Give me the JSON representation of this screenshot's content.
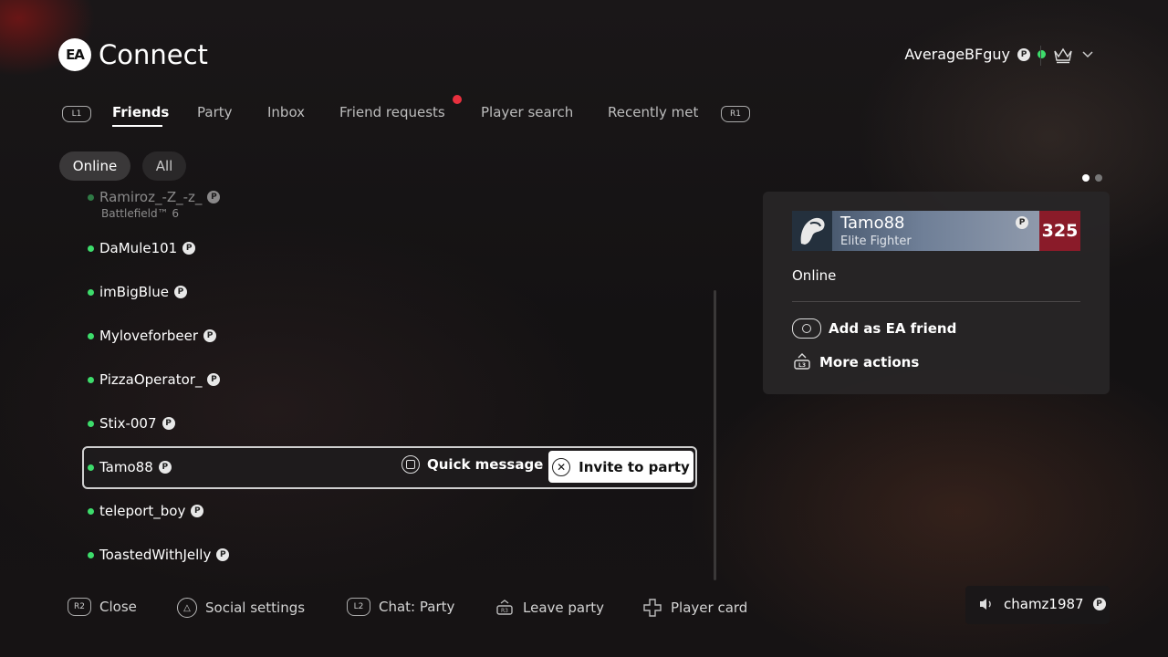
{
  "header": {
    "logo_text": "EA",
    "title": "Connect",
    "username": "AverageBFguy",
    "platform_badge": "ps"
  },
  "tabs": {
    "l_hint": "L1",
    "r_hint": "R1",
    "items": [
      "Friends",
      "Party",
      "Inbox",
      "Friend requests",
      "Player search",
      "Recently met"
    ],
    "active": "Friends"
  },
  "filters": {
    "online": "Online",
    "all": "All",
    "selected": "Online"
  },
  "friends": [
    {
      "name": "Ramiroz_-Z_-z_",
      "game": "Battlefield™ 6"
    },
    {
      "name": "DaMule101"
    },
    {
      "name": "imBigBlue"
    },
    {
      "name": "Myloveforbeer"
    },
    {
      "name": "PizzaOperator_"
    },
    {
      "name": "Stix-007"
    },
    {
      "name": "Tamo88"
    },
    {
      "name": "teleport_boy"
    },
    {
      "name": "ToastedWithJelly"
    }
  ],
  "selected_row": {
    "quick_message": "Quick message",
    "invite": "Invite to party"
  },
  "player_card": {
    "name": "Tamo88",
    "rank": "Elite Fighter",
    "level": "325",
    "status": "Online",
    "action_add": "Add as EA friend",
    "action_more": "More actions"
  },
  "footer": {
    "close_hint": "R2",
    "close": "Close",
    "social": "Social settings",
    "chat_hint": "L2",
    "chat": "Chat: Party",
    "leave_hint": "R3",
    "leave": "Leave party",
    "player_card": "Player card",
    "voice_user": "chamz1987"
  },
  "colors": {
    "online": "#3ddc6b",
    "notification": "#e8303e",
    "level_bg": "#8a1b29"
  }
}
